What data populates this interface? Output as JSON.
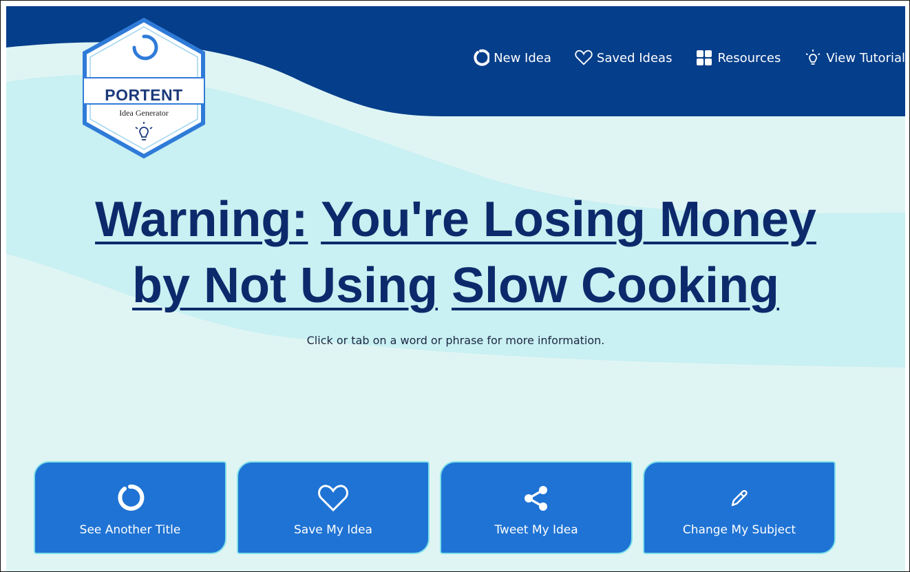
{
  "logo": {
    "title": "PORTENT",
    "subtitle": "Idea Generator"
  },
  "nav": {
    "items": [
      {
        "label": "New Idea",
        "icon": "refresh-icon"
      },
      {
        "label": "Saved Ideas",
        "icon": "heart-icon"
      },
      {
        "label": "Resources",
        "icon": "grid-icon"
      },
      {
        "label": "View Tutorial",
        "icon": "lightbulb-icon"
      }
    ]
  },
  "headline": {
    "phrases": [
      "Warning:",
      "You're Losing Money",
      "by Not Using",
      "Slow Cooking"
    ]
  },
  "hint": "Click or tab on a word or phrase for more information.",
  "actions": [
    {
      "label": "See Another Title",
      "icon": "refresh-icon"
    },
    {
      "label": "Save My Idea",
      "icon": "heart-icon"
    },
    {
      "label": "Tweet My Idea",
      "icon": "share-icon"
    },
    {
      "label": "Change My Subject",
      "icon": "pencil-icon"
    }
  ],
  "colors": {
    "navy": "#053e8a",
    "button": "#1f73d4",
    "headline": "#0c2a6b",
    "background": "#dff5f4"
  }
}
